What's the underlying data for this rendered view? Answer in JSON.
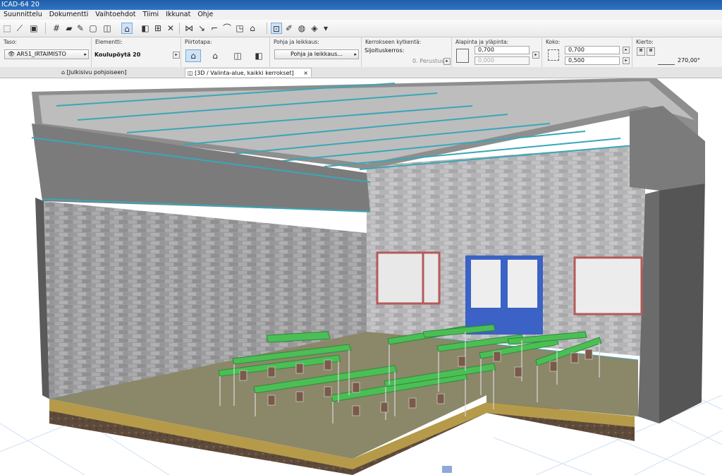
{
  "window": {
    "title": "ICAD-64 20"
  },
  "menu": [
    "Suunnittelu",
    "Dokumentti",
    "Vaihtoehdot",
    "Tiimi",
    "Ikkunat",
    "Ohje"
  ],
  "toolbar": {
    "icons": [
      "select-tool-icon",
      "line-tool-icon",
      "camera-tool-icon",
      "grid-icon",
      "eraser-icon",
      "pen-icon",
      "box-icon",
      "lock-icon",
      "group-icon",
      "layer-icon",
      "ruler-icon",
      "trim-icon",
      "magic-wand-icon",
      "corner-icon",
      "arc-icon",
      "stretch-icon",
      "house-icon",
      "fill-icon",
      "brush-icon",
      "render-icon",
      "paint-bucket-icon"
    ]
  },
  "info": {
    "layer_label": "Taso:",
    "layer_value": "AR51_IRTAIMISTO",
    "element_label": "Elementti:",
    "element_value": "Koulupöytä 20",
    "display_label": "Piirtotapa:",
    "floorplan_label": "Pohja ja leikkaus:",
    "floorplan_button": "Pohja ja leikkaus...",
    "story_label": "Kerrokseen kytkentä:",
    "story_sub": "Sijoituskerros:",
    "story_value": "0. Perustus",
    "elev_label": "Alapinta ja yläpinta:",
    "elev_top": "0,700",
    "elev_bottom": "0,000",
    "size_label": "Koko:",
    "size_a": "0,700",
    "size_b": "0,500",
    "rotate_label": "Kierto:",
    "rotate_value": "270,00°"
  },
  "tabs": [
    {
      "label": "[Julkisivu pohjoiseen]",
      "active": false
    },
    {
      "label": "[3D / Valinta-alue, kaikki kerrokset]",
      "active": true
    }
  ],
  "tab_close": "×",
  "colors": {
    "accent": "#3aa6b9",
    "brick": "#a7a6a7",
    "floor": "#8b8769",
    "desk": "#4bbf55",
    "door": "#3b62c4"
  }
}
